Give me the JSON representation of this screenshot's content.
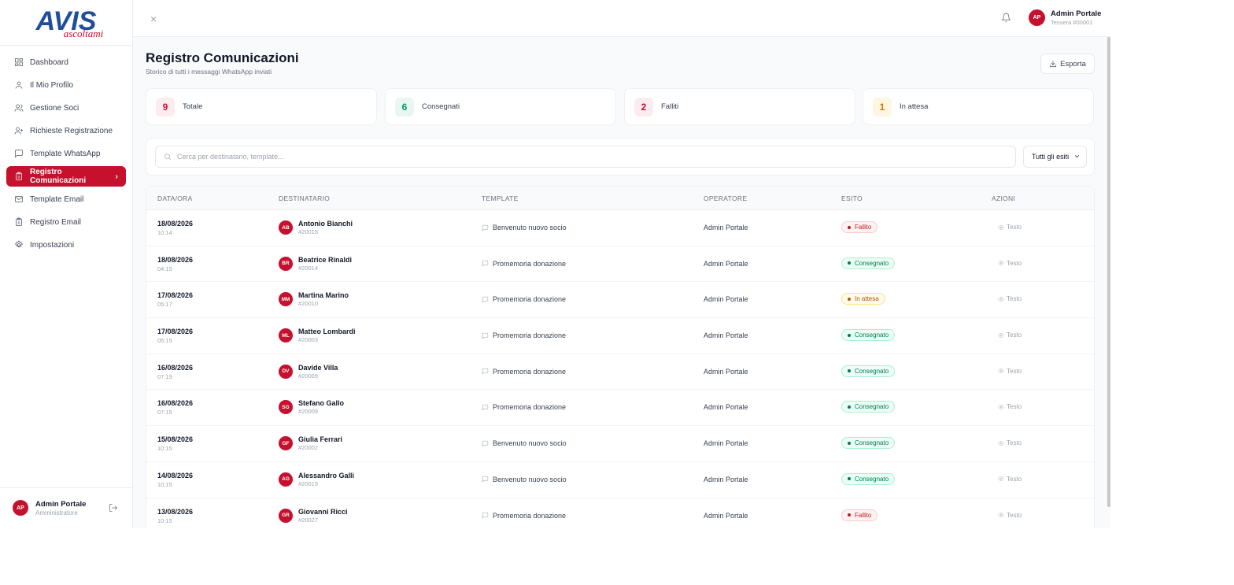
{
  "brand": {
    "logo_text": "AVIS",
    "logo_script": "ascoltami",
    "accent": "#c5102e"
  },
  "sidebar": {
    "items": [
      {
        "label": "Dashboard",
        "icon": "dashboard-icon"
      },
      {
        "label": "Il Mio Profilo",
        "icon": "user-icon"
      },
      {
        "label": "Gestione Soci",
        "icon": "users-icon"
      },
      {
        "label": "Richieste Registrazione",
        "icon": "user-plus-icon"
      },
      {
        "label": "Template WhatsApp",
        "icon": "message-square-icon"
      },
      {
        "label": "Registro Comunicazioni",
        "icon": "clipboard-icon",
        "active": true
      },
      {
        "label": "Template Email",
        "icon": "mail-icon"
      },
      {
        "label": "Registro Email",
        "icon": "clipboard-icon"
      },
      {
        "label": "Impostazioni",
        "icon": "gear-icon"
      }
    ],
    "user": {
      "initials": "AP",
      "name": "Admin Portale",
      "role": "Amministratore"
    }
  },
  "topbar": {
    "close": "×",
    "user": {
      "initials": "AP",
      "name": "Admin Portale",
      "card": "Tessera #00001"
    }
  },
  "page": {
    "title": "Registro Comunicazioni",
    "subtitle": "Storico di tutti i messaggi WhatsApp inviati",
    "export_label": "Esporta"
  },
  "stats": [
    {
      "value": "9",
      "label": "Totale",
      "color": "#c5102e",
      "bg": "#fdecef"
    },
    {
      "value": "6",
      "label": "Consegnati",
      "color": "#059669",
      "bg": "#e8f7f0"
    },
    {
      "value": "2",
      "label": "Falliti",
      "color": "#c5102e",
      "bg": "#fdecef"
    },
    {
      "value": "1",
      "label": "In attesa",
      "color": "#d97706",
      "bg": "#fdf6e3"
    }
  ],
  "filters": {
    "search_placeholder": "Cerca per destinatario, template...",
    "outcome_selected": "Tutti gli esiti"
  },
  "table": {
    "columns": [
      "DATA/ORA",
      "DESTINATARIO",
      "TEMPLATE",
      "OPERATORE",
      "ESITO",
      "AZIONI"
    ],
    "rows": [
      {
        "date": "18/08/2026",
        "time": "10:14",
        "initials": "AB",
        "name": "Antonio Bianchi",
        "id": "#20015",
        "template": "Benvenuto nuovo socio",
        "operator": "Admin Portale",
        "status": "Fallito",
        "status_type": "fail",
        "action": "Testo"
      },
      {
        "date": "18/08/2026",
        "time": "04:15",
        "initials": "BR",
        "name": "Beatrice Rinaldi",
        "id": "#20014",
        "template": "Promemoria donazione",
        "operator": "Admin Portale",
        "status": "Consegnato",
        "status_type": "ok",
        "action": "Testo"
      },
      {
        "date": "17/08/2026",
        "time": "05:17",
        "initials": "MM",
        "name": "Martina Marino",
        "id": "#20010",
        "template": "Promemoria donazione",
        "operator": "Admin Portale",
        "status": "In attesa",
        "status_type": "wait",
        "action": "Testo"
      },
      {
        "date": "17/08/2026",
        "time": "05:15",
        "initials": "ML",
        "name": "Matteo Lombardi",
        "id": "#20003",
        "template": "Promemoria donazione",
        "operator": "Admin Portale",
        "status": "Consegnato",
        "status_type": "ok",
        "action": "Testo"
      },
      {
        "date": "16/08/2026",
        "time": "07:19",
        "initials": "DV",
        "name": "Davide Villa",
        "id": "#20005",
        "template": "Promemoria donazione",
        "operator": "Admin Portale",
        "status": "Consegnato",
        "status_type": "ok",
        "action": "Testo"
      },
      {
        "date": "16/08/2026",
        "time": "07:15",
        "initials": "SG",
        "name": "Stefano Gallo",
        "id": "#20009",
        "template": "Promemoria donazione",
        "operator": "Admin Portale",
        "status": "Consegnato",
        "status_type": "ok",
        "action": "Testo"
      },
      {
        "date": "15/08/2026",
        "time": "10:15",
        "initials": "GF",
        "name": "Giulia Ferrari",
        "id": "#20002",
        "template": "Benvenuto nuovo socio",
        "operator": "Admin Portale",
        "status": "Consegnato",
        "status_type": "ok",
        "action": "Testo"
      },
      {
        "date": "14/08/2026",
        "time": "10:15",
        "initials": "AG",
        "name": "Alessandro Galli",
        "id": "#20019",
        "template": "Benvenuto nuovo socio",
        "operator": "Admin Portale",
        "status": "Consegnato",
        "status_type": "ok",
        "action": "Testo"
      },
      {
        "date": "13/08/2026",
        "time": "10:15",
        "initials": "GR",
        "name": "Giovanni Ricci",
        "id": "#20027",
        "template": "Promemoria donazione",
        "operator": "Admin Portale",
        "status": "Fallito",
        "status_type": "fail",
        "action": "Testo"
      }
    ]
  }
}
